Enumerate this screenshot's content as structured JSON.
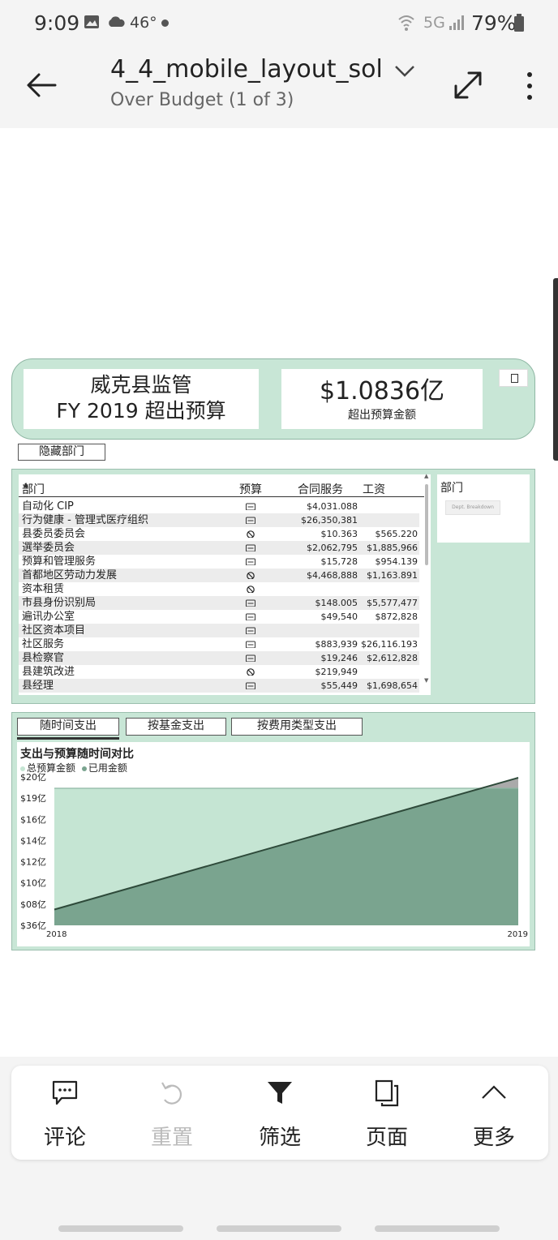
{
  "status_bar": {
    "time": "9:09",
    "temperature": "46°",
    "network": "5G",
    "battery": "79%",
    "icons": [
      "image-icon",
      "cloud-icon",
      "wifi-icon",
      "signal-icon",
      "battery-icon"
    ]
  },
  "app_bar": {
    "title": "4_4_mobile_layout_sol...",
    "subtitle": "Over Budget (1 of 3)",
    "icons": [
      "back-arrow-icon",
      "chevron-down-icon",
      "expand-icon",
      "more-vertical-icon"
    ]
  },
  "report": {
    "title_line1": "威克县监管",
    "title_line2": "FY 2019 超出预算",
    "kpi_value": "$1.0836亿",
    "kpi_label": "超出预算金额",
    "hide_departments_button": "隐藏部门",
    "table": {
      "headers": {
        "dept": "部门",
        "budget": "预算",
        "services": "合同服务",
        "salary": "工资"
      },
      "rows": [
        {
          "dept": "自动化 CIP",
          "budget_icon": "card-icon",
          "services": "$4,031.088",
          "salary": ""
        },
        {
          "dept": "行为健康 - 管理式医疗组织",
          "budget_icon": "card-icon",
          "services": "$26,350,381",
          "salary": ""
        },
        {
          "dept": "县委员委员会",
          "budget_icon": "no-entry-icon",
          "services": "$10.363",
          "salary": "$565.220"
        },
        {
          "dept": "選举委员会",
          "budget_icon": "card-icon",
          "services": "$2,062,795",
          "salary": "$1,885,966"
        },
        {
          "dept": "预算和管理服务",
          "budget_icon": "card-icon",
          "services": "$15,728",
          "salary": "$954.139"
        },
        {
          "dept": "首都地区劳动力发展",
          "budget_icon": "no-entry-icon",
          "services": "$4,468,888",
          "salary": "$1,163.891"
        },
        {
          "dept": "资本租赁",
          "budget_icon": "no-entry-icon",
          "services": "",
          "salary": ""
        },
        {
          "dept": "市县身份识别局",
          "budget_icon": "card-icon",
          "services": "$148.005",
          "salary": "$5,577,477"
        },
        {
          "dept": "遍讯办公室",
          "budget_icon": "card-icon",
          "services": "$49,540",
          "salary": "$872,828"
        },
        {
          "dept": "社区资本项目",
          "budget_icon": "card-icon",
          "services": "",
          "salary": ""
        },
        {
          "dept": "社区服务",
          "budget_icon": "card-icon",
          "services": "$883,939",
          "salary": "$26,116.193"
        },
        {
          "dept": "县检察官",
          "budget_icon": "card-icon",
          "services": "$19,246",
          "salary": "$2,612,828"
        },
        {
          "dept": "县建筑改进",
          "budget_icon": "no-entry-icon",
          "services": "$219,949",
          "salary": ""
        },
        {
          "dept": "县经理",
          "budget_icon": "card-icon",
          "services": "$55,449",
          "salary": "$1,698,654"
        }
      ]
    },
    "slicer": {
      "title": "部门",
      "chip": "Dept. Breakdown"
    },
    "tabs": [
      "随时间支出",
      "按基金支出",
      "按费用类型支出"
    ],
    "colors": {
      "panel_bg": "#c8e6d6",
      "budget_fill": "#c5e5d3",
      "spent_fill": "#7aa48f",
      "line": "#2e4a3a",
      "over_fill": "#aaaaaa"
    }
  },
  "chart_data": {
    "type": "area",
    "title": "支出与预算随时间对比",
    "legend": [
      "总预算金额",
      "已用金额"
    ],
    "xlabel": "",
    "ylabel": "",
    "x": [
      "2018",
      "2019"
    ],
    "y_tick_labels": [
      "$36亿",
      "$08亿",
      "$10亿",
      "$12亿",
      "$14亿",
      "$16亿",
      "$19亿",
      "$20亿"
    ],
    "series": [
      {
        "name": "总预算金额",
        "values": [
          19,
          19
        ]
      },
      {
        "name": "已用金额",
        "values": [
          7.5,
          20
        ]
      }
    ],
    "ylim": [
      6,
      20
    ],
    "legend_position": "top-left"
  },
  "toolbar": {
    "items": [
      {
        "label": "评论",
        "icon": "comment-icon",
        "enabled": true
      },
      {
        "label": "重置",
        "icon": "reset-icon",
        "enabled": false
      },
      {
        "label": "筛选",
        "icon": "filter-icon",
        "enabled": true
      },
      {
        "label": "页面",
        "icon": "pages-icon",
        "enabled": true
      },
      {
        "label": "更多",
        "icon": "chevron-up-icon",
        "enabled": true
      }
    ]
  }
}
